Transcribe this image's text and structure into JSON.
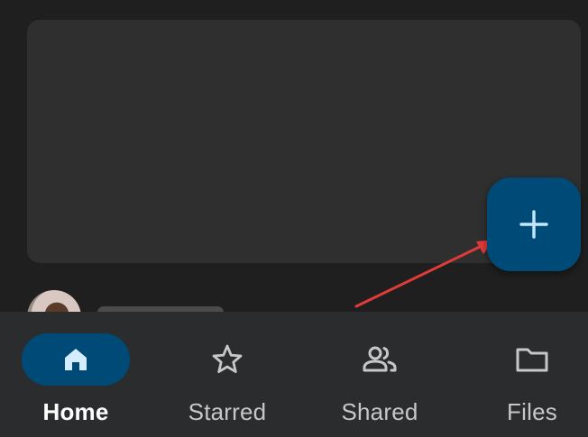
{
  "fab": {
    "icon": "plus-icon"
  },
  "colors": {
    "background": "#1f1f1f",
    "card": "#2f2f2f",
    "fab": "#004a77",
    "active_pill": "#004a77",
    "nav_bar": "#2b2c2e",
    "annotation_arrow": "#e03a3a"
  },
  "bottom_nav": {
    "items": [
      {
        "label": "Home",
        "icon": "home-icon",
        "active": true
      },
      {
        "label": "Starred",
        "icon": "star-icon",
        "active": false
      },
      {
        "label": "Shared",
        "icon": "people-icon",
        "active": false
      },
      {
        "label": "Files",
        "icon": "folder-icon",
        "active": false
      }
    ]
  }
}
